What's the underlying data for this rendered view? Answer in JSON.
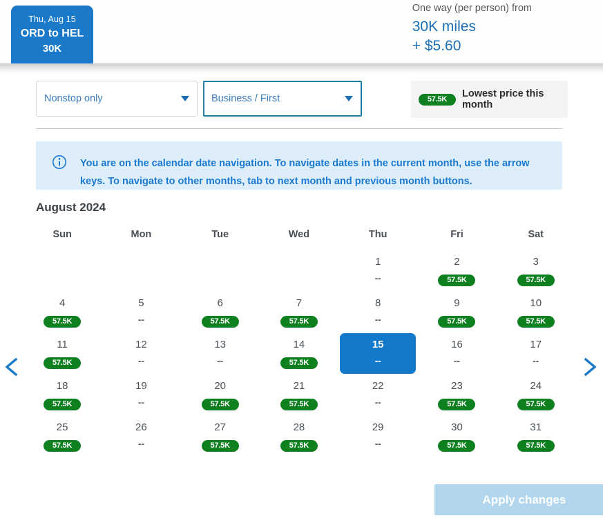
{
  "header": {
    "trip_card": {
      "date": "Thu, Aug 15",
      "route": "ORD to HEL",
      "miles": "30K"
    },
    "price": {
      "label": "One way (per person) from",
      "miles": "30K miles",
      "fee": "+ $5.60"
    }
  },
  "filters": {
    "stops_select": {
      "value": "Nonstop only",
      "caret_icon": "chevron-down-icon"
    },
    "cabin_select": {
      "value": "Business / First",
      "caret_icon": "chevron-down-icon"
    },
    "legend": {
      "badge": "57.5K",
      "text": "Lowest price this month"
    }
  },
  "info_banner": {
    "icon": "info-circle-icon",
    "text": "You are on the calendar date navigation. To navigate dates in the current month, use the arrow keys. To navigate to other months, tab to next month and previous month buttons."
  },
  "calendar": {
    "month_title": "August 2024",
    "weekdays": [
      "Sun",
      "Mon",
      "Tue",
      "Wed",
      "Thu",
      "Fri",
      "Sat"
    ],
    "selected_day": 15,
    "no_price_text": "--",
    "prev_icon": "chevron-left-icon",
    "next_icon": "chevron-right-icon",
    "weeks": [
      [
        {
          "day": "",
          "price": ""
        },
        {
          "day": "",
          "price": ""
        },
        {
          "day": "",
          "price": ""
        },
        {
          "day": "",
          "price": ""
        },
        {
          "day": "1",
          "price": "--"
        },
        {
          "day": "2",
          "price": "57.5K"
        },
        {
          "day": "3",
          "price": "57.5K"
        }
      ],
      [
        {
          "day": "4",
          "price": "57.5K"
        },
        {
          "day": "5",
          "price": "--"
        },
        {
          "day": "6",
          "price": "57.5K"
        },
        {
          "day": "7",
          "price": "57.5K"
        },
        {
          "day": "8",
          "price": "--"
        },
        {
          "day": "9",
          "price": "57.5K"
        },
        {
          "day": "10",
          "price": "57.5K"
        }
      ],
      [
        {
          "day": "11",
          "price": "57.5K"
        },
        {
          "day": "12",
          "price": "--"
        },
        {
          "day": "13",
          "price": "--"
        },
        {
          "day": "14",
          "price": "57.5K"
        },
        {
          "day": "15",
          "price": "--",
          "selected": true
        },
        {
          "day": "16",
          "price": "--"
        },
        {
          "day": "17",
          "price": "--"
        }
      ],
      [
        {
          "day": "18",
          "price": "57.5K"
        },
        {
          "day": "19",
          "price": "--"
        },
        {
          "day": "20",
          "price": "57.5K"
        },
        {
          "day": "21",
          "price": "57.5K"
        },
        {
          "day": "22",
          "price": "--"
        },
        {
          "day": "23",
          "price": "57.5K"
        },
        {
          "day": "24",
          "price": "57.5K"
        }
      ],
      [
        {
          "day": "25",
          "price": "57.5K"
        },
        {
          "day": "26",
          "price": "--"
        },
        {
          "day": "27",
          "price": "57.5K"
        },
        {
          "day": "28",
          "price": "57.5K"
        },
        {
          "day": "29",
          "price": "--"
        },
        {
          "day": "30",
          "price": "57.5K"
        },
        {
          "day": "31",
          "price": "57.5K"
        }
      ]
    ]
  },
  "footer": {
    "apply_label": "Apply changes"
  },
  "colors": {
    "brand_blue": "#1b79c9",
    "link_blue": "#3b7dbe",
    "price_blue": "#1b6eb3",
    "badge_green": "#0f8020",
    "info_bg": "#ddedfa",
    "info_text": "#1b7ad0",
    "focus_teal": "#1d7ea3",
    "apply_disabled": "#b3d6ef"
  }
}
